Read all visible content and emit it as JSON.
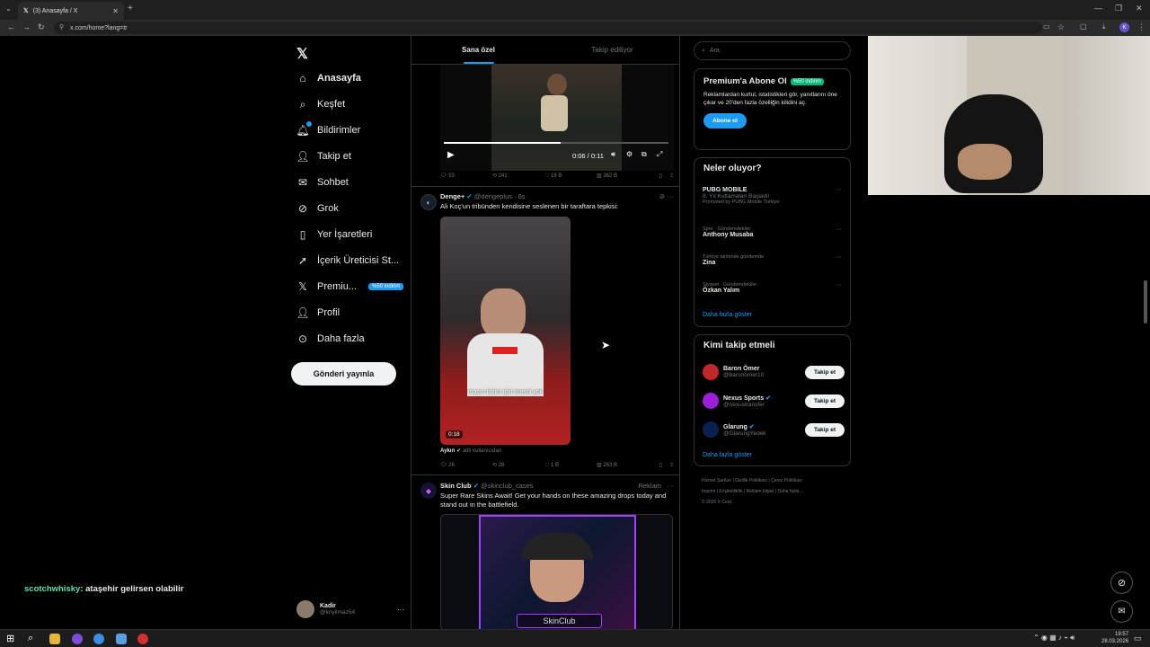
{
  "browser": {
    "tab_title": "(3) Anasayfa / X",
    "url": "x.com/home?lang=tr"
  },
  "nav": {
    "items": [
      {
        "label": "Anasayfa",
        "icon": "home-icon"
      },
      {
        "label": "Keşfet",
        "icon": "search-icon"
      },
      {
        "label": "Bildirimler",
        "icon": "bell-icon"
      },
      {
        "label": "Takip et",
        "icon": "follow-icon"
      },
      {
        "label": "Sohbet",
        "icon": "mail-icon"
      },
      {
        "label": "Grok",
        "icon": "grok-icon"
      },
      {
        "label": "Yer İşaretleri",
        "icon": "bookmark-icon"
      },
      {
        "label": "İçerik Üreticisi St...",
        "icon": "rocket-icon"
      },
      {
        "label": "Premiu...",
        "icon": "x-logo-icon"
      },
      {
        "label": "Profil",
        "icon": "person-icon"
      },
      {
        "label": "Daha fazla",
        "icon": "more-circle-icon"
      }
    ],
    "premium_badge": "%50 indirim",
    "post_button": "Gönderi yayınla",
    "account": {
      "name": "Kadir",
      "handle": "@knyilmaz54"
    }
  },
  "feed": {
    "tabs": [
      "Sana özel",
      "Takip ediliyor"
    ],
    "post0": {
      "video_time": "0:06 / 0:11",
      "replies": "53",
      "reposts": "241",
      "likes": "18 B",
      "views": "362 B"
    },
    "post1": {
      "author": "Denge+",
      "handle": "@dengeplus",
      "time": "· 6s",
      "text": "Ali Koç'un tribünden kendisine seslenen bir taraftara tepkisi:",
      "caption": "maçın bizim için önemi yok",
      "duration": "0:18",
      "source_label": "Aykırı",
      "source_sub": "adlı kullanıcıdan",
      "replies": "26",
      "reposts": "28",
      "likes": "1 B",
      "views": "263 B"
    },
    "post2": {
      "author": "Skin Club",
      "handle": "@skinclub_cases",
      "ad_label": "Reklam",
      "text": "Super Rare Skins Await! Get your hands on these amazing drops today and stand out in the battlefield.",
      "brand": "SkinClub"
    }
  },
  "sidebar": {
    "search_placeholder": "Ara",
    "premium": {
      "title": "Premium'a Abone Ol",
      "badge": "%50 indirim",
      "desc": "Reklamlardan kurtul, istatistikleri gör, yanıtlarını öne çıkar ve 20'den fazla özelliğin kilidini aç.",
      "button": "Abone ol"
    },
    "trends": {
      "title": "Neler oluyor?",
      "items": [
        {
          "meta": "",
          "name": "PUBG MOBILE",
          "sub": "8. Yıl Kutlamaları Başladı!",
          "promo": "Promoted by PUBG Mobile Türkiye"
        },
        {
          "meta": "Spor · Gündemdekiler",
          "name": "Anthony Musaba"
        },
        {
          "meta": "Türkiye tarihinde gündemde",
          "name": "Zina"
        },
        {
          "meta": "Siyaset · Gündemdekiler",
          "name": "Özkan Yalım"
        }
      ],
      "more": "Daha fazla göster"
    },
    "who_to_follow": {
      "title": "Kimi takip etmeli",
      "items": [
        {
          "name": "Baron Ömer",
          "handle": "@baronomer10",
          "verified": false
        },
        {
          "name": "Nexus Sports",
          "handle": "@nexustransfer",
          "verified": true
        },
        {
          "name": "Glarung",
          "handle": "@GlarungYedek",
          "verified": true
        }
      ],
      "follow_label": "Takip et",
      "more": "Daha fazla göster"
    },
    "footer": [
      "Hizmet Şartları",
      "Gizlilik Politikası",
      "Çerez Politikası",
      "Imprint",
      "Erişilebilirlik",
      "Reklam bilgisi",
      "Daha fazla ...",
      "© 2026 X Corp."
    ]
  },
  "chat": {
    "user": "scotchwhisky",
    "message": ": ataşehir gelirsen olabilir"
  },
  "taskbar": {
    "time": "19:57",
    "date": "28.03.2026"
  }
}
